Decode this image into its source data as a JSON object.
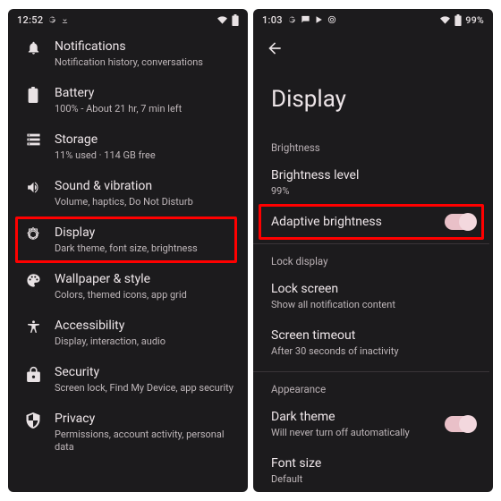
{
  "left": {
    "status": {
      "time": "12:52",
      "battery_pct": ""
    },
    "items": [
      {
        "title": "Notifications",
        "subtitle": "Notification history, conversations"
      },
      {
        "title": "Battery",
        "subtitle": "100% - About 21 hr, 7 min left"
      },
      {
        "title": "Storage",
        "subtitle": "11% used · 114 GB free"
      },
      {
        "title": "Sound & vibration",
        "subtitle": "Volume, haptics, Do Not Disturb"
      },
      {
        "title": "Display",
        "subtitle": "Dark theme, font size, brightness"
      },
      {
        "title": "Wallpaper & style",
        "subtitle": "Colors, themed icons, app grid"
      },
      {
        "title": "Accessibility",
        "subtitle": "Display, interaction, audio"
      },
      {
        "title": "Security",
        "subtitle": "Screen lock, Find My Device, app security"
      },
      {
        "title": "Privacy",
        "subtitle": "Permissions, account activity, personal data"
      }
    ],
    "highlight_index": 4
  },
  "right": {
    "status": {
      "time": "1:03",
      "battery_pct": "99%"
    },
    "page_title": "Display",
    "sections": {
      "brightness": {
        "label": "Brightness",
        "items": [
          {
            "title": "Brightness level",
            "subtitle": "99%",
            "toggle": null
          },
          {
            "title": "Adaptive brightness",
            "subtitle": "",
            "toggle": true
          }
        ],
        "highlight_index": 1
      },
      "lock": {
        "label": "Lock display",
        "items": [
          {
            "title": "Lock screen",
            "subtitle": "Show all notification content",
            "toggle": null
          },
          {
            "title": "Screen timeout",
            "subtitle": "After 30 seconds of inactivity",
            "toggle": null
          }
        ]
      },
      "appearance": {
        "label": "Appearance",
        "items": [
          {
            "title": "Dark theme",
            "subtitle": "Will never turn off automatically",
            "toggle": true
          },
          {
            "title": "Font size",
            "subtitle": "Default",
            "toggle": null
          }
        ]
      }
    }
  }
}
